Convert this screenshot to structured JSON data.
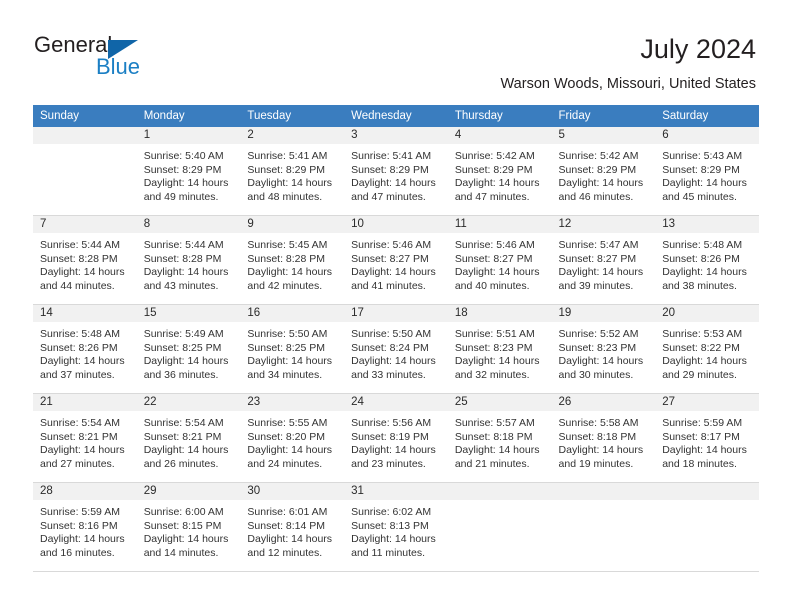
{
  "brand": {
    "name_part1": "General",
    "name_part2": "Blue",
    "triangle_color": "#1065a8",
    "blue_color": "#1b7fc4"
  },
  "header": {
    "title": "July 2024",
    "location": "Warson Woods, Missouri, United States"
  },
  "theme": {
    "header_bg": "#3a7dbf",
    "daynum_bg": "#f1f1f1",
    "grid_line": "#d9d9d9",
    "text": "#333333"
  },
  "calendar": {
    "weekday_headers": [
      "Sunday",
      "Monday",
      "Tuesday",
      "Wednesday",
      "Thursday",
      "Friday",
      "Saturday"
    ],
    "weeks": [
      [
        {
          "day": "",
          "sunrise": "",
          "sunset": "",
          "daylight_line1": "",
          "daylight_line2": ""
        },
        {
          "day": "1",
          "sunrise": "Sunrise: 5:40 AM",
          "sunset": "Sunset: 8:29 PM",
          "daylight_line1": "Daylight: 14 hours",
          "daylight_line2": "and 49 minutes."
        },
        {
          "day": "2",
          "sunrise": "Sunrise: 5:41 AM",
          "sunset": "Sunset: 8:29 PM",
          "daylight_line1": "Daylight: 14 hours",
          "daylight_line2": "and 48 minutes."
        },
        {
          "day": "3",
          "sunrise": "Sunrise: 5:41 AM",
          "sunset": "Sunset: 8:29 PM",
          "daylight_line1": "Daylight: 14 hours",
          "daylight_line2": "and 47 minutes."
        },
        {
          "day": "4",
          "sunrise": "Sunrise: 5:42 AM",
          "sunset": "Sunset: 8:29 PM",
          "daylight_line1": "Daylight: 14 hours",
          "daylight_line2": "and 47 minutes."
        },
        {
          "day": "5",
          "sunrise": "Sunrise: 5:42 AM",
          "sunset": "Sunset: 8:29 PM",
          "daylight_line1": "Daylight: 14 hours",
          "daylight_line2": "and 46 minutes."
        },
        {
          "day": "6",
          "sunrise": "Sunrise: 5:43 AM",
          "sunset": "Sunset: 8:29 PM",
          "daylight_line1": "Daylight: 14 hours",
          "daylight_line2": "and 45 minutes."
        }
      ],
      [
        {
          "day": "7",
          "sunrise": "Sunrise: 5:44 AM",
          "sunset": "Sunset: 8:28 PM",
          "daylight_line1": "Daylight: 14 hours",
          "daylight_line2": "and 44 minutes."
        },
        {
          "day": "8",
          "sunrise": "Sunrise: 5:44 AM",
          "sunset": "Sunset: 8:28 PM",
          "daylight_line1": "Daylight: 14 hours",
          "daylight_line2": "and 43 minutes."
        },
        {
          "day": "9",
          "sunrise": "Sunrise: 5:45 AM",
          "sunset": "Sunset: 8:28 PM",
          "daylight_line1": "Daylight: 14 hours",
          "daylight_line2": "and 42 minutes."
        },
        {
          "day": "10",
          "sunrise": "Sunrise: 5:46 AM",
          "sunset": "Sunset: 8:27 PM",
          "daylight_line1": "Daylight: 14 hours",
          "daylight_line2": "and 41 minutes."
        },
        {
          "day": "11",
          "sunrise": "Sunrise: 5:46 AM",
          "sunset": "Sunset: 8:27 PM",
          "daylight_line1": "Daylight: 14 hours",
          "daylight_line2": "and 40 minutes."
        },
        {
          "day": "12",
          "sunrise": "Sunrise: 5:47 AM",
          "sunset": "Sunset: 8:27 PM",
          "daylight_line1": "Daylight: 14 hours",
          "daylight_line2": "and 39 minutes."
        },
        {
          "day": "13",
          "sunrise": "Sunrise: 5:48 AM",
          "sunset": "Sunset: 8:26 PM",
          "daylight_line1": "Daylight: 14 hours",
          "daylight_line2": "and 38 minutes."
        }
      ],
      [
        {
          "day": "14",
          "sunrise": "Sunrise: 5:48 AM",
          "sunset": "Sunset: 8:26 PM",
          "daylight_line1": "Daylight: 14 hours",
          "daylight_line2": "and 37 minutes."
        },
        {
          "day": "15",
          "sunrise": "Sunrise: 5:49 AM",
          "sunset": "Sunset: 8:25 PM",
          "daylight_line1": "Daylight: 14 hours",
          "daylight_line2": "and 36 minutes."
        },
        {
          "day": "16",
          "sunrise": "Sunrise: 5:50 AM",
          "sunset": "Sunset: 8:25 PM",
          "daylight_line1": "Daylight: 14 hours",
          "daylight_line2": "and 34 minutes."
        },
        {
          "day": "17",
          "sunrise": "Sunrise: 5:50 AM",
          "sunset": "Sunset: 8:24 PM",
          "daylight_line1": "Daylight: 14 hours",
          "daylight_line2": "and 33 minutes."
        },
        {
          "day": "18",
          "sunrise": "Sunrise: 5:51 AM",
          "sunset": "Sunset: 8:23 PM",
          "daylight_line1": "Daylight: 14 hours",
          "daylight_line2": "and 32 minutes."
        },
        {
          "day": "19",
          "sunrise": "Sunrise: 5:52 AM",
          "sunset": "Sunset: 8:23 PM",
          "daylight_line1": "Daylight: 14 hours",
          "daylight_line2": "and 30 minutes."
        },
        {
          "day": "20",
          "sunrise": "Sunrise: 5:53 AM",
          "sunset": "Sunset: 8:22 PM",
          "daylight_line1": "Daylight: 14 hours",
          "daylight_line2": "and 29 minutes."
        }
      ],
      [
        {
          "day": "21",
          "sunrise": "Sunrise: 5:54 AM",
          "sunset": "Sunset: 8:21 PM",
          "daylight_line1": "Daylight: 14 hours",
          "daylight_line2": "and 27 minutes."
        },
        {
          "day": "22",
          "sunrise": "Sunrise: 5:54 AM",
          "sunset": "Sunset: 8:21 PM",
          "daylight_line1": "Daylight: 14 hours",
          "daylight_line2": "and 26 minutes."
        },
        {
          "day": "23",
          "sunrise": "Sunrise: 5:55 AM",
          "sunset": "Sunset: 8:20 PM",
          "daylight_line1": "Daylight: 14 hours",
          "daylight_line2": "and 24 minutes."
        },
        {
          "day": "24",
          "sunrise": "Sunrise: 5:56 AM",
          "sunset": "Sunset: 8:19 PM",
          "daylight_line1": "Daylight: 14 hours",
          "daylight_line2": "and 23 minutes."
        },
        {
          "day": "25",
          "sunrise": "Sunrise: 5:57 AM",
          "sunset": "Sunset: 8:18 PM",
          "daylight_line1": "Daylight: 14 hours",
          "daylight_line2": "and 21 minutes."
        },
        {
          "day": "26",
          "sunrise": "Sunrise: 5:58 AM",
          "sunset": "Sunset: 8:18 PM",
          "daylight_line1": "Daylight: 14 hours",
          "daylight_line2": "and 19 minutes."
        },
        {
          "day": "27",
          "sunrise": "Sunrise: 5:59 AM",
          "sunset": "Sunset: 8:17 PM",
          "daylight_line1": "Daylight: 14 hours",
          "daylight_line2": "and 18 minutes."
        }
      ],
      [
        {
          "day": "28",
          "sunrise": "Sunrise: 5:59 AM",
          "sunset": "Sunset: 8:16 PM",
          "daylight_line1": "Daylight: 14 hours",
          "daylight_line2": "and 16 minutes."
        },
        {
          "day": "29",
          "sunrise": "Sunrise: 6:00 AM",
          "sunset": "Sunset: 8:15 PM",
          "daylight_line1": "Daylight: 14 hours",
          "daylight_line2": "and 14 minutes."
        },
        {
          "day": "30",
          "sunrise": "Sunrise: 6:01 AM",
          "sunset": "Sunset: 8:14 PM",
          "daylight_line1": "Daylight: 14 hours",
          "daylight_line2": "and 12 minutes."
        },
        {
          "day": "31",
          "sunrise": "Sunrise: 6:02 AM",
          "sunset": "Sunset: 8:13 PM",
          "daylight_line1": "Daylight: 14 hours",
          "daylight_line2": "and 11 minutes."
        },
        {
          "day": "",
          "sunrise": "",
          "sunset": "",
          "daylight_line1": "",
          "daylight_line2": ""
        },
        {
          "day": "",
          "sunrise": "",
          "sunset": "",
          "daylight_line1": "",
          "daylight_line2": ""
        },
        {
          "day": "",
          "sunrise": "",
          "sunset": "",
          "daylight_line1": "",
          "daylight_line2": ""
        }
      ]
    ]
  }
}
